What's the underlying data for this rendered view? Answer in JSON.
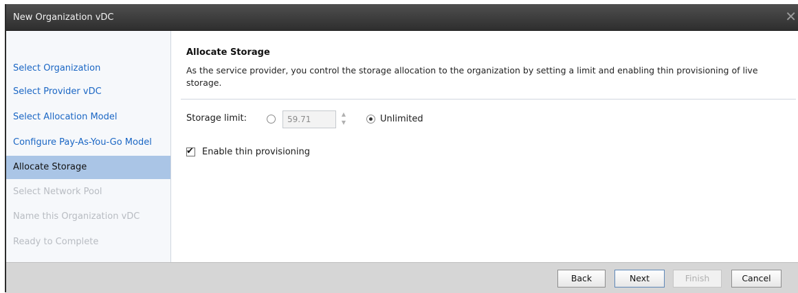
{
  "window": {
    "title": "New Organization vDC"
  },
  "sidebar": {
    "items": [
      {
        "label": "Select Organization",
        "state": "link"
      },
      {
        "label": "Select Provider vDC",
        "state": "link"
      },
      {
        "label": "Select Allocation Model",
        "state": "link"
      },
      {
        "label": "Configure Pay-As-You-Go Model",
        "state": "link"
      },
      {
        "label": "Allocate Storage",
        "state": "current"
      },
      {
        "label": "Select Network Pool",
        "state": "disabled"
      },
      {
        "label": "Name this Organization vDC",
        "state": "disabled"
      },
      {
        "label": "Ready to Complete",
        "state": "disabled"
      }
    ]
  },
  "main": {
    "heading": "Allocate Storage",
    "description": "As the service provider, you control the storage allocation to the organization by setting a limit and enabling thin provisioning of live storage.",
    "storage_limit": {
      "label": "Storage limit:",
      "value": "59.71",
      "unlimited_label": "Unlimited",
      "selected": "unlimited"
    },
    "thin_provisioning": {
      "label": "Enable thin provisioning",
      "checked": true
    }
  },
  "footer": {
    "back_label": "Back",
    "next_label": "Next",
    "finish_label": "Finish",
    "cancel_label": "Cancel"
  },
  "colors": {
    "link": "#1a66c4",
    "selected_nav": "#aac5e6",
    "titlebar": "#3a3a3a"
  }
}
